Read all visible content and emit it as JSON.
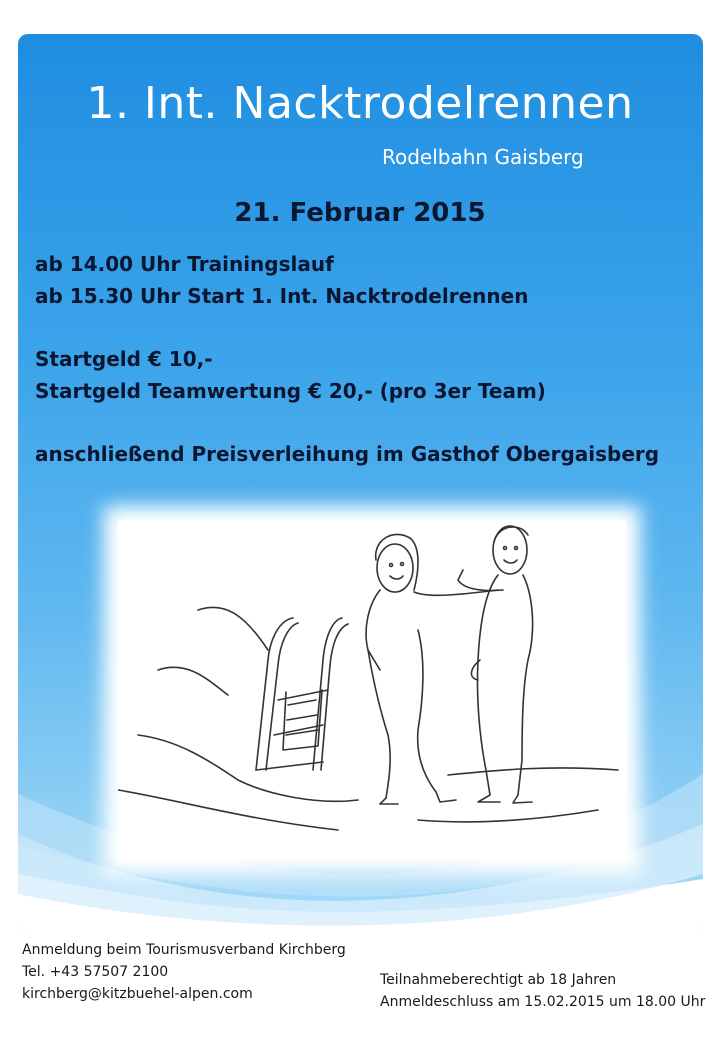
{
  "poster": {
    "title": "1. Int. Nacktrodelrennen",
    "subtitle": "Rodelbahn Gaisberg",
    "date": "21. Februar 2015",
    "schedule": [
      "ab 14.00 Uhr Trainingslauf",
      "ab 15.30 Uhr  Start  1. Int. Nacktrodelrennen"
    ],
    "fees": [
      "Startgeld € 10,-",
      "Startgeld Teamwertung € 20,- (pro 3er Team)"
    ],
    "award": "anschließend Preisverleihung im Gasthof Obergaisberg"
  },
  "footer": {
    "registration": "Anmeldung beim Tourismusverband Kirchberg",
    "phone": "Tel. +43 57507 2100",
    "email": "kirchberg@kitzbuehel-alpen.com",
    "eligibility": "Teilnahmeberechtigt ab 18 Jahren",
    "deadline": "Anmeldeschluss  am 15.02.2015 um 18.00 Uhr"
  },
  "colors": {
    "background_top": "#1f8de0",
    "background_bottom": "#a9dcf8",
    "heading_text": "#ffffff",
    "body_text": "#0b1630"
  }
}
